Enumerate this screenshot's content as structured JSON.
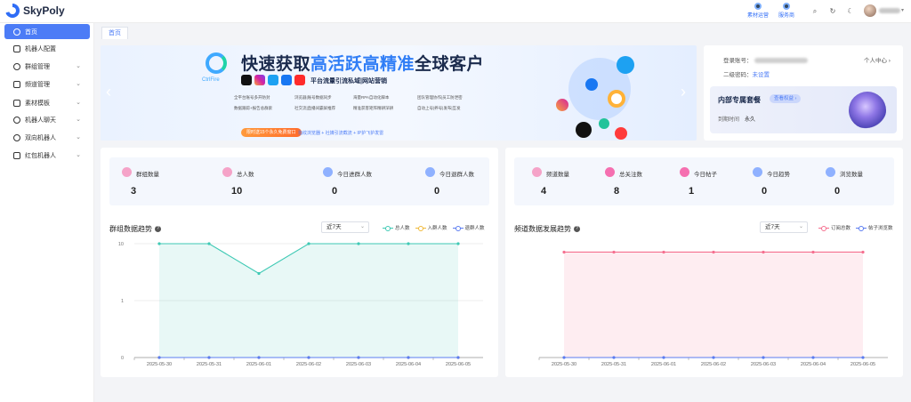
{
  "app": {
    "name": "SkyPoly"
  },
  "topbar": {
    "links": [
      {
        "label": "素材运营",
        "icon": "operator-icon"
      },
      {
        "label": "服务商",
        "icon": "service-icon"
      }
    ],
    "icons": [
      "search-icon",
      "refresh-icon",
      "moon-icon"
    ]
  },
  "sidebar": {
    "items": [
      {
        "label": "首页",
        "icon": "home-icon",
        "active": true,
        "has_children": false
      },
      {
        "label": "机器人配置",
        "icon": "robot-icon",
        "active": false,
        "has_children": false
      },
      {
        "label": "群组管理",
        "icon": "group-icon",
        "active": false,
        "has_children": true
      },
      {
        "label": "频道管理",
        "icon": "channel-icon",
        "active": false,
        "has_children": true
      },
      {
        "label": "素材模板",
        "icon": "template-icon",
        "active": false,
        "has_children": true
      },
      {
        "label": "机器人聊天",
        "icon": "chat-icon",
        "active": false,
        "has_children": true
      },
      {
        "label": "双向机器人",
        "icon": "two-way-icon",
        "active": false,
        "has_children": true
      },
      {
        "label": "红包机器人",
        "icon": "red-packet-icon",
        "active": false,
        "has_children": true
      }
    ]
  },
  "tabs": [
    {
      "label": "首页"
    }
  ],
  "banner": {
    "logo_text": "CtrlFire",
    "title_prefix": "快速获取",
    "title_highlight": "高活跃高精准",
    "title_suffix": "全球客户",
    "subtitle": "平台流量引流私域|网站营销",
    "features": [
      "全平台账号多开防封",
      "浏览器|账号数据同步",
      "海量RPA自动化脚本",
      "团队管理协作|员工防泄密",
      "数据跟踪+报告总群索",
      "社交流|直播间霸屏推荐",
      "精准获客矩阵精耕深耕",
      "自动上号|养号|发布|互发"
    ],
    "cta": "限时送15个永久免费窗口",
    "footer": "指纹浏览器 + 社媒引流截流 + IP护飞护发雷"
  },
  "account": {
    "login_label": "登录账号：",
    "profile_link": "个人中心",
    "secondary_password_label": "二级密码：",
    "secondary_password_value": "未设置",
    "package_title": "内部专属套餐",
    "package_button": "查看权益",
    "expire_label": "到期时间",
    "expire_value": "永久"
  },
  "group_stats": [
    {
      "label": "群组数量",
      "value": "3",
      "icon": "group-count-icon",
      "color": "#f5a3c8"
    },
    {
      "label": "总人数",
      "value": "10",
      "icon": "people-icon",
      "color": "#f5a3c8"
    },
    {
      "label": "今日进群人数",
      "value": "0",
      "icon": "join-icon",
      "color": "#8fb1ff"
    },
    {
      "label": "今日退群人数",
      "value": "0",
      "icon": "leave-icon",
      "color": "#8fb1ff"
    }
  ],
  "channel_stats": [
    {
      "label": "频道数量",
      "value": "4",
      "icon": "channel-count-icon",
      "color": "#f5a3c8"
    },
    {
      "label": "总关注数",
      "value": "8",
      "icon": "star-icon",
      "color": "#f56fb0"
    },
    {
      "label": "今日帖子",
      "value": "1",
      "icon": "post-icon",
      "color": "#f56fb0"
    },
    {
      "label": "今日趋势",
      "value": "0",
      "icon": "trend-icon",
      "color": "#8fb1ff"
    },
    {
      "label": "浏览数量",
      "value": "0",
      "icon": "view-icon",
      "color": "#8fb1ff"
    }
  ],
  "group_chart": {
    "title": "群组数据趋势",
    "select": "近7天"
  },
  "channel_chart": {
    "title": "频道数据发展趋势",
    "select": "近7天"
  },
  "chart_data": [
    {
      "type": "area",
      "title": "群组数据趋势",
      "categories": [
        "2025-05-30",
        "2025-05-31",
        "2025-06-01",
        "2025-06-02",
        "2025-06-03",
        "2025-06-04",
        "2025-06-05"
      ],
      "y_ticks": [
        "0",
        "1",
        "10"
      ],
      "y_scale": "log",
      "legend_position": "top-right",
      "series": [
        {
          "name": "总人数",
          "values": [
            10,
            10,
            3,
            10,
            10,
            10,
            10
          ],
          "color": "#3ec9b4"
        },
        {
          "name": "入群人数",
          "values": [
            0,
            0,
            0,
            0,
            0,
            0,
            0
          ],
          "color": "#f0b93a"
        },
        {
          "name": "退群人数",
          "values": [
            0,
            0,
            0,
            0,
            0,
            0,
            0
          ],
          "color": "#5b7cf0"
        }
      ]
    },
    {
      "type": "area",
      "title": "频道数据发展趋势",
      "categories": [
        "2025-05-30",
        "2025-05-31",
        "2025-06-01",
        "2025-06-02",
        "2025-06-03",
        "2025-06-04",
        "2025-06-05"
      ],
      "y_ticks": [],
      "legend_position": "top-right",
      "series": [
        {
          "name": "订阅总数",
          "values": [
            8,
            8,
            8,
            8,
            8,
            8,
            8
          ],
          "color": "#f56f8f"
        },
        {
          "name": "帖子浏览数",
          "values": [
            0,
            0,
            0,
            0,
            0,
            0,
            0
          ],
          "color": "#5b7cf0"
        }
      ]
    }
  ]
}
